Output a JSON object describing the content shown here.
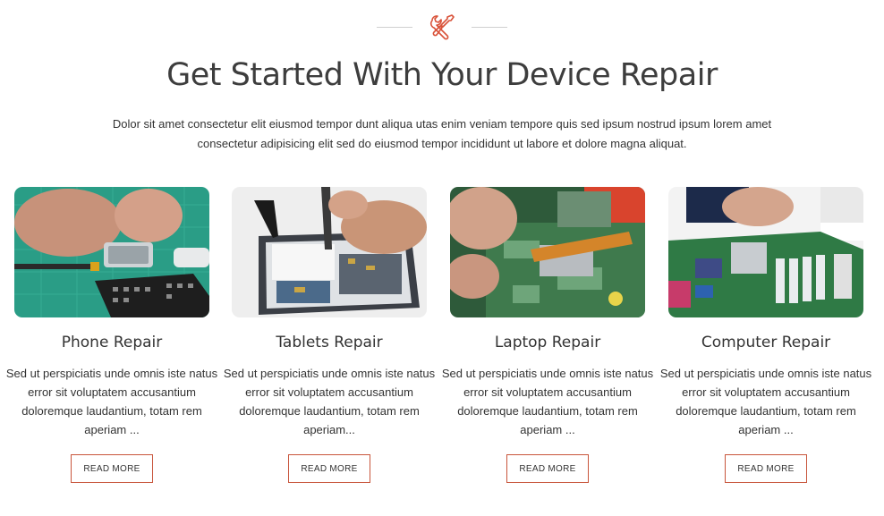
{
  "header": {
    "icon": "tools-icon",
    "accent_color": "#d9533a",
    "title": "Get Started With Your Device Repair",
    "intro": "Dolor sit amet consectetur elit eiusmod tempor dunt aliqua utas enim veniam tempore quis sed ipsum nostrud ipsum lorem amet consectetur adipisicing elit sed do eiusmod tempor incididunt ut labore et dolore magna aliquat."
  },
  "cards": [
    {
      "title": "Phone Repair",
      "description": "Sed ut perspiciatis unde omnis iste natus error sit voluptatem accusantium doloremque laudantium, totam rem aperiam ...",
      "button": "READ MORE",
      "image": "phone-repair-photo"
    },
    {
      "title": "Tablets Repair",
      "description": "Sed ut perspiciatis unde omnis iste natus error sit voluptatem accusantium doloremque laudantium, totam rem aperiam...",
      "button": "READ MORE",
      "image": "tablet-repair-photo"
    },
    {
      "title": "Laptop Repair",
      "description": "Sed ut perspiciatis unde omnis iste natus error sit voluptatem accusantium doloremque laudantium, totam rem aperiam ...",
      "button": "READ MORE",
      "image": "laptop-repair-photo"
    },
    {
      "title": "Computer Repair",
      "description": "Sed ut perspiciatis unde omnis iste natus error sit voluptatem accusantium doloremque laudantium, totam rem aperiam ...",
      "button": "READ MORE",
      "image": "computer-repair-photo"
    }
  ],
  "button_border_color": "#c8553b"
}
